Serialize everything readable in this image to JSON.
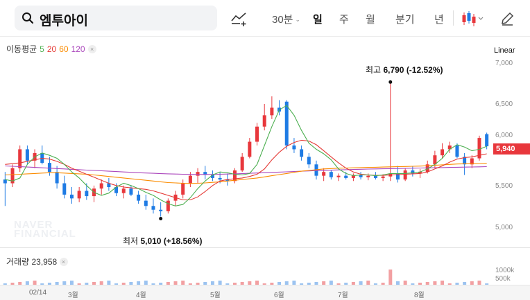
{
  "search": {
    "query": "엠투아이",
    "icon": "search-icon"
  },
  "toolbar": {
    "draw_icon": "trend-line-add-icon",
    "periods": [
      "30분",
      "일",
      "주",
      "월",
      "분기",
      "년"
    ],
    "selected_period": "일",
    "chart_type_icon": "candlestick-icon",
    "edit_icon": "pencil-icon"
  },
  "indicators": {
    "ma_label": "이동평균",
    "ma": [
      {
        "period": "5",
        "color": "#4caf50"
      },
      {
        "period": "20",
        "color": "#e53935"
      },
      {
        "period": "60",
        "color": "#fb8c00"
      },
      {
        "period": "120",
        "color": "#ab47bc"
      }
    ],
    "remove": "×"
  },
  "scale_mode": "Linear",
  "watermark": [
    "NAVER",
    "FINANCIAL"
  ],
  "price_axis": {
    "ticks": [
      "7,000",
      "6,500",
      "6,000",
      "5,500",
      "5,000"
    ],
    "current": "5,940",
    "range": [
      4850,
      7050
    ]
  },
  "volume_axis": {
    "ticks": [
      "1000k",
      "500k"
    ]
  },
  "annotations": {
    "high": {
      "label": "최고",
      "value": "6,790",
      "change": "(-12.52%)"
    },
    "low": {
      "label": "최저",
      "value": "5,010",
      "change": "(+18.56%)"
    }
  },
  "volume": {
    "label": "거래량",
    "value": "23,958"
  },
  "x_axis": {
    "labels": [
      "02/14",
      "3월",
      "4월",
      "5월",
      "6월",
      "7월",
      "8월"
    ]
  },
  "colors": {
    "up": "#e8373c",
    "down": "#1e7be4",
    "accent": "#e8373c"
  },
  "chart_data": {
    "type": "candlestick",
    "ylim": [
      4850,
      7050
    ],
    "ma5": [
      5500,
      5480,
      5520,
      5700,
      5800,
      5850,
      5820,
      5780,
      5700,
      5600,
      5520,
      5420,
      5330,
      5290,
      5320,
      5400,
      5450,
      5420,
      5380,
      5330,
      5290,
      5230,
      5180,
      5150,
      5170,
      5260,
      5380,
      5480,
      5560,
      5600,
      5590,
      5570,
      5560,
      5580,
      5700,
      5950,
      6200,
      6420,
      6480,
      6350,
      6150,
      5980,
      5900,
      5840,
      5760,
      5640,
      5580,
      5550,
      5560,
      5560,
      5550,
      5560,
      5580,
      5580,
      5580,
      5590,
      5600,
      5640,
      5700,
      5780,
      5900,
      5960,
      5930,
      5880,
      5900,
      5940
    ],
    "ma20": [
      5700,
      5710,
      5720,
      5740,
      5760,
      5780,
      5770,
      5740,
      5700,
      5650,
      5610,
      5570,
      5530,
      5490,
      5450,
      5420,
      5400,
      5390,
      5380,
      5370,
      5350,
      5320,
      5290,
      5260,
      5230,
      5230,
      5270,
      5340,
      5420,
      5480,
      5500,
      5510,
      5520,
      5540,
      5570,
      5640,
      5760,
      5860,
      5940,
      5990,
      6020,
      6010,
      5960,
      5880,
      5800,
      5720,
      5650,
      5600,
      5570,
      5560,
      5555,
      5555,
      5560,
      5565,
      5570,
      5575,
      5580,
      5600,
      5640,
      5680,
      5730,
      5770,
      5790,
      5800,
      5820,
      5840
    ],
    "ma60": [
      5560,
      5565,
      5570,
      5575,
      5580,
      5585,
      5590,
      5590,
      5585,
      5580,
      5575,
      5570,
      5560,
      5550,
      5540,
      5530,
      5520,
      5510,
      5500,
      5490,
      5480,
      5470,
      5460,
      5455,
      5450,
      5448,
      5450,
      5455,
      5462,
      5470,
      5480,
      5490,
      5500,
      5510,
      5520,
      5535,
      5550,
      5565,
      5580,
      5595,
      5610,
      5620,
      5630,
      5640,
      5645,
      5650,
      5652,
      5655,
      5658,
      5660,
      5662,
      5665,
      5668,
      5670,
      5672,
      5675,
      5678,
      5682,
      5688,
      5694,
      5700,
      5705,
      5708,
      5710,
      5712,
      5714
    ],
    "ma120": [
      5680,
      5675,
      5670,
      5665,
      5660,
      5655,
      5650,
      5645,
      5640,
      5635,
      5630,
      5625,
      5620,
      5615,
      5610,
      5605,
      5600,
      5595,
      5590,
      5586,
      5582,
      5578,
      5575,
      5572,
      5570,
      5568,
      5567,
      5567,
      5568,
      5570,
      5572,
      5575,
      5578,
      5582,
      5586,
      5590,
      5594,
      5598,
      5602,
      5606,
      5610,
      5614,
      5618,
      5621,
      5624,
      5627,
      5630,
      5633,
      5636,
      5638,
      5640,
      5642,
      5644,
      5646,
      5648,
      5650,
      5652,
      5654,
      5656,
      5658,
      5660,
      5662,
      5664,
      5666,
      5668,
      5670
    ],
    "candles": [
      {
        "o": 5500,
        "h": 5600,
        "l": 5150,
        "c": 5450
      },
      {
        "o": 5450,
        "h": 5700,
        "l": 5400,
        "c": 5650
      },
      {
        "o": 5650,
        "h": 5950,
        "l": 5600,
        "c": 5900
      },
      {
        "o": 5900,
        "h": 5950,
        "l": 5700,
        "c": 5750
      },
      {
        "o": 5750,
        "h": 5900,
        "l": 5650,
        "c": 5850
      },
      {
        "o": 5850,
        "h": 5950,
        "l": 5700,
        "c": 5720
      },
      {
        "o": 5720,
        "h": 5800,
        "l": 5550,
        "c": 5600
      },
      {
        "o": 5600,
        "h": 5680,
        "l": 5380,
        "c": 5450
      },
      {
        "o": 5450,
        "h": 5550,
        "l": 5250,
        "c": 5300
      },
      {
        "o": 5300,
        "h": 5400,
        "l": 5180,
        "c": 5250
      },
      {
        "o": 5250,
        "h": 5400,
        "l": 5200,
        "c": 5350
      },
      {
        "o": 5350,
        "h": 5450,
        "l": 5230,
        "c": 5280
      },
      {
        "o": 5280,
        "h": 5420,
        "l": 5200,
        "c": 5380
      },
      {
        "o": 5380,
        "h": 5500,
        "l": 5300,
        "c": 5450
      },
      {
        "o": 5450,
        "h": 5520,
        "l": 5350,
        "c": 5400
      },
      {
        "o": 5400,
        "h": 5450,
        "l": 5280,
        "c": 5320
      },
      {
        "o": 5320,
        "h": 5420,
        "l": 5250,
        "c": 5380
      },
      {
        "o": 5380,
        "h": 5420,
        "l": 5280,
        "c": 5300
      },
      {
        "o": 5300,
        "h": 5350,
        "l": 5180,
        "c": 5220
      },
      {
        "o": 5220,
        "h": 5300,
        "l": 5100,
        "c": 5150
      },
      {
        "o": 5150,
        "h": 5250,
        "l": 5050,
        "c": 5100
      },
      {
        "o": 5100,
        "h": 5200,
        "l": 5010,
        "c": 5080
      },
      {
        "o": 5080,
        "h": 5250,
        "l": 5050,
        "c": 5220
      },
      {
        "o": 5220,
        "h": 5350,
        "l": 5150,
        "c": 5300
      },
      {
        "o": 5300,
        "h": 5500,
        "l": 5250,
        "c": 5450
      },
      {
        "o": 5450,
        "h": 5600,
        "l": 5400,
        "c": 5550
      },
      {
        "o": 5550,
        "h": 5650,
        "l": 5450,
        "c": 5600
      },
      {
        "o": 5600,
        "h": 5680,
        "l": 5500,
        "c": 5560
      },
      {
        "o": 5560,
        "h": 5620,
        "l": 5480,
        "c": 5520
      },
      {
        "o": 5520,
        "h": 5600,
        "l": 5450,
        "c": 5500
      },
      {
        "o": 5500,
        "h": 5580,
        "l": 5420,
        "c": 5480
      },
      {
        "o": 5480,
        "h": 5650,
        "l": 5450,
        "c": 5620
      },
      {
        "o": 5620,
        "h": 5850,
        "l": 5600,
        "c": 5800
      },
      {
        "o": 5800,
        "h": 6050,
        "l": 5780,
        "c": 6000
      },
      {
        "o": 6000,
        "h": 6250,
        "l": 5950,
        "c": 6200
      },
      {
        "o": 6200,
        "h": 6500,
        "l": 6150,
        "c": 6350
      },
      {
        "o": 6350,
        "h": 6600,
        "l": 6300,
        "c": 6450
      },
      {
        "o": 6450,
        "h": 6550,
        "l": 6350,
        "c": 6400
      },
      {
        "o": 6530,
        "h": 6550,
        "l": 5900,
        "c": 5950
      },
      {
        "o": 5950,
        "h": 6050,
        "l": 5850,
        "c": 5900
      },
      {
        "o": 5900,
        "h": 5950,
        "l": 5750,
        "c": 5800
      },
      {
        "o": 5800,
        "h": 5850,
        "l": 5650,
        "c": 5700
      },
      {
        "o": 5700,
        "h": 5750,
        "l": 5500,
        "c": 5550
      },
      {
        "o": 5550,
        "h": 5650,
        "l": 5480,
        "c": 5600
      },
      {
        "o": 5600,
        "h": 5620,
        "l": 5500,
        "c": 5530
      },
      {
        "o": 5530,
        "h": 5580,
        "l": 5480,
        "c": 5550
      },
      {
        "o": 5550,
        "h": 5600,
        "l": 5500,
        "c": 5520
      },
      {
        "o": 5520,
        "h": 5580,
        "l": 5480,
        "c": 5560
      },
      {
        "o": 5560,
        "h": 5600,
        "l": 5500,
        "c": 5530
      },
      {
        "o": 5530,
        "h": 5580,
        "l": 5490,
        "c": 5550
      },
      {
        "o": 5550,
        "h": 5600,
        "l": 5500,
        "c": 5520
      },
      {
        "o": 5520,
        "h": 5570,
        "l": 5480,
        "c": 5540
      },
      {
        "o": 5540,
        "h": 6790,
        "l": 5480,
        "c": 5580
      },
      {
        "o": 5580,
        "h": 5680,
        "l": 5460,
        "c": 5500
      },
      {
        "o": 5500,
        "h": 5650,
        "l": 5480,
        "c": 5620
      },
      {
        "o": 5620,
        "h": 5680,
        "l": 5540,
        "c": 5580
      },
      {
        "o": 5580,
        "h": 5640,
        "l": 5520,
        "c": 5600
      },
      {
        "o": 5600,
        "h": 5750,
        "l": 5580,
        "c": 5700
      },
      {
        "o": 5700,
        "h": 5880,
        "l": 5650,
        "c": 5820
      },
      {
        "o": 5820,
        "h": 5980,
        "l": 5780,
        "c": 5900
      },
      {
        "o": 5900,
        "h": 6000,
        "l": 5850,
        "c": 5950
      },
      {
        "o": 5950,
        "h": 5980,
        "l": 5780,
        "c": 5800
      },
      {
        "o": 5800,
        "h": 5850,
        "l": 5560,
        "c": 5700
      },
      {
        "o": 5700,
        "h": 5820,
        "l": 5650,
        "c": 5780
      },
      {
        "o": 5780,
        "h": 6080,
        "l": 5750,
        "c": 6050
      },
      {
        "o": 6100,
        "h": 6120,
        "l": 5900,
        "c": 5940
      }
    ]
  }
}
